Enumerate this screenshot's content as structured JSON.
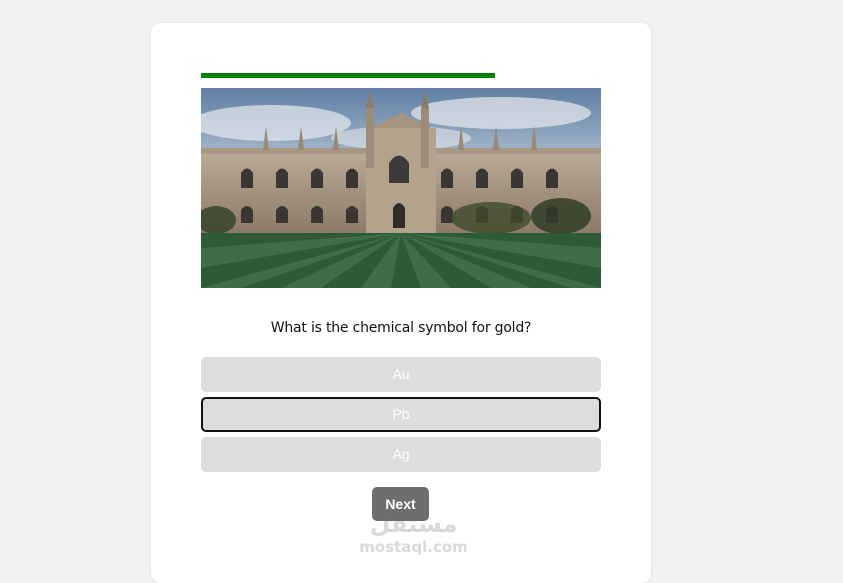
{
  "quiz": {
    "progress": 0.735,
    "progress_color": "#008000",
    "image": {
      "subject": "gothic-college-building-with-striped-lawn"
    },
    "question": "What is the chemical symbol for gold?",
    "options": [
      {
        "label": "Au",
        "selected": false
      },
      {
        "label": "Pb",
        "selected": true
      },
      {
        "label": "Ag",
        "selected": false
      }
    ],
    "next_label": "Next"
  },
  "watermark": {
    "arabic": "مستقل",
    "latin": "mostaql.com"
  },
  "colors": {
    "page_bg": "#f2f2f2",
    "card_bg": "#ffffff",
    "option_bg": "#dddddd",
    "next_bg": "#6e6e6e"
  }
}
